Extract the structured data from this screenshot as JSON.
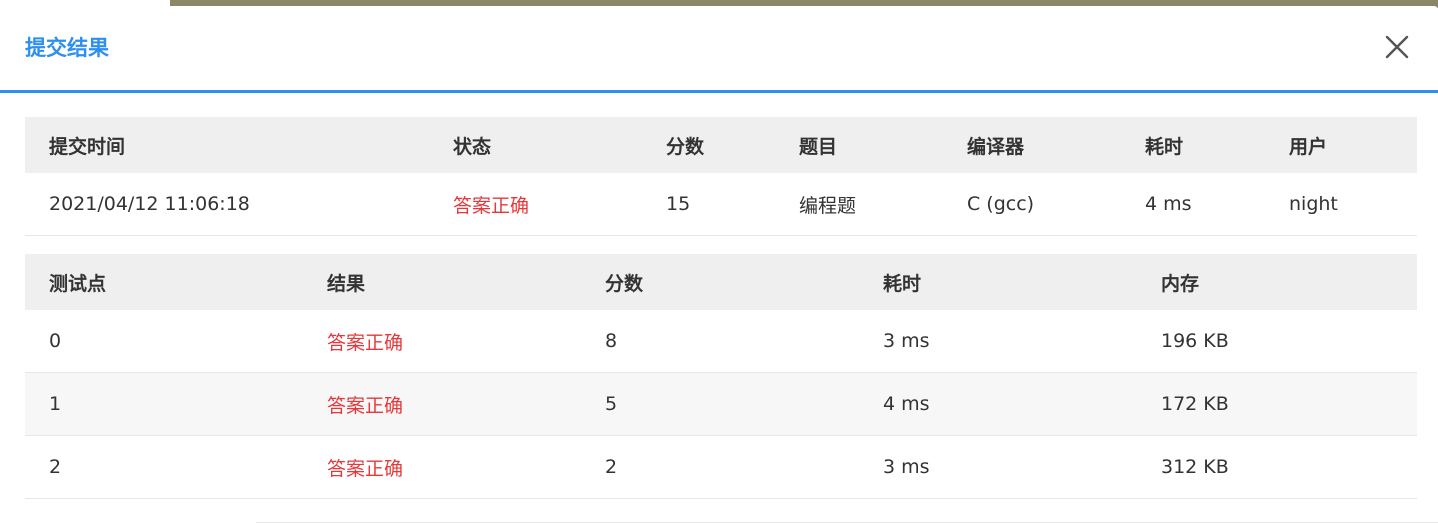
{
  "modal": {
    "title": "提交结果"
  },
  "submission": {
    "headers": [
      "提交时间",
      "状态",
      "分数",
      "题目",
      "编译器",
      "耗时",
      "用户"
    ],
    "row": {
      "time": "2021/04/12 11:06:18",
      "status": "答案正确",
      "score": "15",
      "problem": "编程题",
      "compiler": "C (gcc)",
      "duration": "4 ms",
      "user": "night"
    }
  },
  "testcases": {
    "headers": [
      "测试点",
      "结果",
      "分数",
      "耗时",
      "内存"
    ],
    "rows": [
      {
        "id": "0",
        "result": "答案正确",
        "score": "8",
        "duration": "3 ms",
        "memory": "196 KB"
      },
      {
        "id": "1",
        "result": "答案正确",
        "score": "5",
        "duration": "4 ms",
        "memory": "172 KB"
      },
      {
        "id": "2",
        "result": "答案正确",
        "score": "2",
        "duration": "3 ms",
        "memory": "312 KB"
      }
    ]
  },
  "colors": {
    "accent": "#2d8ff0",
    "success_text": "#e4393c",
    "header_bg": "#efefef"
  },
  "icons": {
    "close": "close-icon"
  }
}
